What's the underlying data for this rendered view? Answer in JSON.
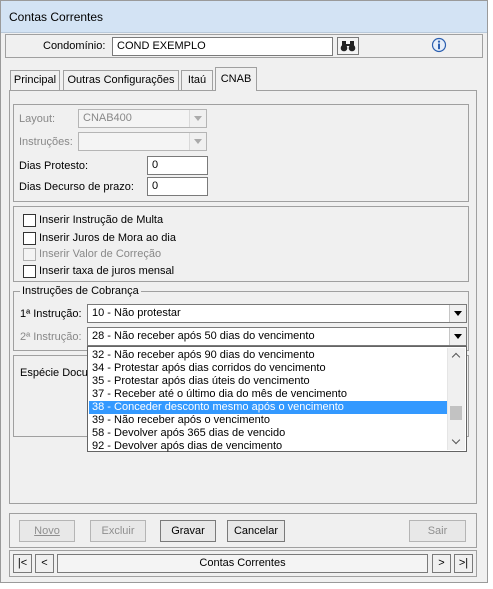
{
  "window": {
    "title": "Contas Correntes"
  },
  "header": {
    "condominio_label": "Condomínio:",
    "condominio_value": "COND EXEMPLO",
    "search_icon": "binoculars-icon",
    "help_icon": "info-icon"
  },
  "tabs": [
    {
      "label": "Principal"
    },
    {
      "label": "Outras Configurações"
    },
    {
      "label": "Itaú"
    },
    {
      "label": "CNAB",
      "active": true
    }
  ],
  "cnab": {
    "layout_label": "Layout:",
    "layout_value": "CNAB400",
    "instrucoes_label": "Instruções:",
    "instrucoes_value": "",
    "dias_protesto_label": "Dias Protesto:",
    "dias_protesto_value": "0",
    "dias_decurso_label": "Dias Decurso de prazo:",
    "dias_decurso_value": "0"
  },
  "checkboxes": [
    {
      "label": "Inserir Instrução de Multa",
      "checked": false,
      "enabled": true
    },
    {
      "label": "Inserir Juros de Mora ao dia",
      "checked": false,
      "enabled": true
    },
    {
      "label": "Inserir Valor de Correção",
      "checked": false,
      "enabled": false
    },
    {
      "label": "Inserir taxa de juros mensal",
      "checked": false,
      "enabled": true
    }
  ],
  "instrucoes_cobranca": {
    "group_label": "Instruções de Cobrança",
    "instrucao1_label": "1ª Instrução:",
    "instrucao1_value": "10 - Não protestar",
    "instrucao2_label": "2ª Instrução:",
    "instrucao2_value": "28 - Não receber após 50 dias do vencimento"
  },
  "especie": {
    "label": "Espécie Docum"
  },
  "dropdown_options": [
    {
      "label": "32 - Não receber após 90 dias do vencimento"
    },
    {
      "label": "34 - Protestar após dias corridos do vencimento"
    },
    {
      "label": "35 - Protestar após dias úteis do vencimento"
    },
    {
      "label": "37 - Receber até o último dia do mês de vencimento"
    },
    {
      "label": "38 - Conceder desconto mesmo após o vencimento",
      "selected": true
    },
    {
      "label": "39 - Não receber após o vencimento"
    },
    {
      "label": "58 - Devolver após 365 dias de vencido"
    },
    {
      "label": "92 - Devolver após dias de vencimento"
    }
  ],
  "buttons": {
    "novo": "Novo",
    "excluir": "Excluir",
    "gravar": "Gravar",
    "cancelar": "Cancelar",
    "sair": "Sair"
  },
  "navigator": {
    "first": "|<",
    "prev": "<",
    "caption": "Contas Correntes",
    "next": ">",
    "last": ">|"
  },
  "colors": {
    "selection": "#3399ff",
    "titlebar": "#d3e3f4",
    "background": "#f0f0f0"
  }
}
